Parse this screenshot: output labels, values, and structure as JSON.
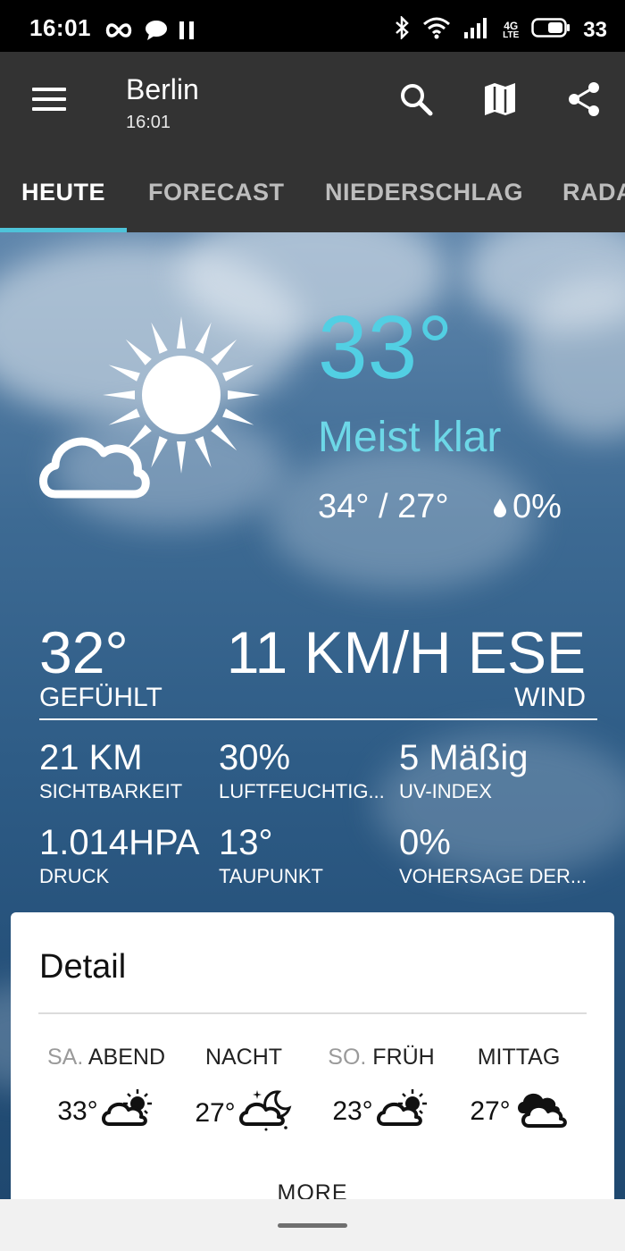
{
  "status_bar": {
    "time": "16:01",
    "battery": "33",
    "icons_left": [
      "infinity-icon",
      "chat-bubble-icon",
      "pause-icon"
    ],
    "icons_right": [
      "bluetooth-icon",
      "wifi-icon",
      "signal-icon",
      "4g-lte-icon",
      "battery-icon"
    ],
    "network": "4G",
    "network_sub": "LTE"
  },
  "appbar": {
    "city": "Berlin",
    "time": "16:01",
    "actions": [
      "search-icon",
      "map-icon",
      "share-icon"
    ]
  },
  "tabs": [
    {
      "label": "HEUTE",
      "active": true
    },
    {
      "label": "FORECAST",
      "active": false
    },
    {
      "label": "NIEDERSCHLAG",
      "active": false
    },
    {
      "label": "RADAR",
      "active": false
    }
  ],
  "current": {
    "temperature": "33°",
    "condition": "Meist klar",
    "hi_lo": "34° / 27°",
    "precipitation": "0%",
    "feels_like": "32°",
    "feels_like_label": "GEFÜHLT",
    "wind": "11 KM/H ESE",
    "wind_label": "WIND"
  },
  "stats": [
    {
      "value": "21 KM",
      "label": "SICHTBARKEIT"
    },
    {
      "value": "30%",
      "label": "LUFTFEUCHTIG..."
    },
    {
      "value": "5 Mäßig",
      "label": "UV-INDEX"
    },
    {
      "value": "1.014HPA",
      "label": "DRUCK"
    },
    {
      "value": "13°",
      "label": "TAUPUNKT"
    },
    {
      "value": "0%",
      "label": "VOHERSAGE DER..."
    }
  ],
  "detail": {
    "title": "Detail",
    "periods": [
      {
        "day": "SA.",
        "name": "ABEND",
        "temp": "33°",
        "icon": "partly-sunny-icon"
      },
      {
        "day": "",
        "name": "NACHT",
        "temp": "27°",
        "icon": "partly-cloudy-night-icon"
      },
      {
        "day": "SO.",
        "name": "FRÜH",
        "temp": "23°",
        "icon": "partly-sunny-icon"
      },
      {
        "day": "",
        "name": "MITTAG",
        "temp": "27°",
        "icon": "cloudy-icon"
      }
    ],
    "more_label": "MORE"
  },
  "colors": {
    "accent": "#4ec3d9",
    "temperature": "#52cfe3",
    "appbar": "#333333"
  }
}
